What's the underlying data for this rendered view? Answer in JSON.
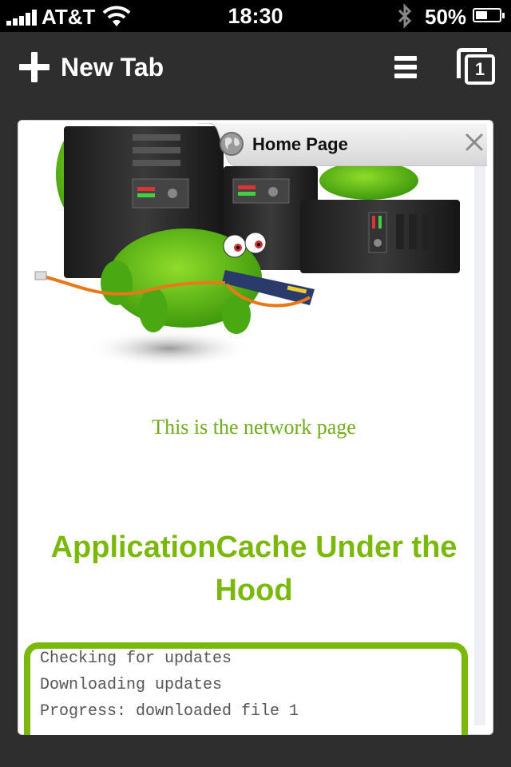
{
  "status_bar": {
    "carrier": "AT&T",
    "time": "18:30",
    "battery": "50%"
  },
  "toolbar": {
    "new_tab_label": "New Tab",
    "tab_count": "1"
  },
  "tab": {
    "title": "Home Page"
  },
  "page": {
    "network_text": "This is the network page",
    "heading": "ApplicationCache Under the Hood",
    "log_lines": [
      "Checking for updates",
      "Downloading updates",
      "Progress: downloaded file 1"
    ]
  },
  "colors": {
    "accent_green": "#7ab80c",
    "background": "#2e2e2e"
  },
  "icons": [
    "signal-icon",
    "wifi-icon",
    "bluetooth-icon",
    "battery-icon",
    "plus-icon",
    "menu-icon",
    "tabs-icon",
    "globe-icon",
    "close-icon"
  ]
}
